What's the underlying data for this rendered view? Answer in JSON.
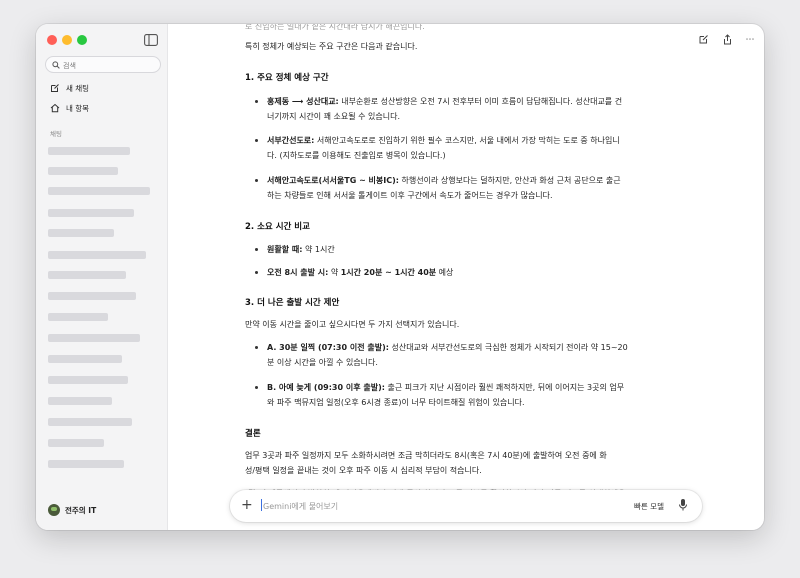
{
  "sidebar": {
    "search_placeholder": "검색",
    "new_chat": "새 채팅",
    "my_items": "내 항목",
    "section_chats": "채팅",
    "profile_name": "전주의 IT"
  },
  "content": {
    "faded_top": "로 진입하는 일대가 짙은 시간대라 답시가 해끈입니다.",
    "intro": "특히 정체가 예상되는 주요 구간은 다음과 같습니다.",
    "s1_title": "1. 주요 정체 예상 구간",
    "s1_b1_bold": "홍제동 ⟶ 성산대교:",
    "s1_b1_l1": " 내부순환로 성산방향은 오전 7시 전후부터 이미 흐름이 답답해집니다. 성산대교를 건",
    "s1_b1_l2": "너기까지 시간이 꽤 소요될 수 있습니다.",
    "s1_b2_bold": "서부간선도로:",
    "s1_b2_l1": " 서해안고속도로로 진입하기 위한 필수 코스지만, 서울 내에서 가장 막히는 도로 중 하나입니",
    "s1_b2_l2": "다. (지하도로를 이용해도 진출입로 병목이 있습니다.)",
    "s1_b3_bold": "서해안고속도로(서서울TG ~ 비봉IC):",
    "s1_b3_l1": " 하행선이라 상행보다는 덜하지만, 안산과 화성 근처 공단으로 출근",
    "s1_b3_l2": "하는 차량들로 인해 서서울 톨게이트 이후 구간에서 속도가 줄어드는 경우가 많습니다.",
    "s2_title": "2. 소요 시간 비교",
    "s2_b1_bold": "원활할 때:",
    "s2_b1_text": " 약 1시간",
    "s2_b2_bold": "오전 8시 출발 시:",
    "s2_b2_text": " 약 ",
    "s2_b2_value": "1시간 20분 ~ 1시간 40분",
    "s2_b2_tail": " 예상",
    "s3_title": "3. 더 나은 출발 시간 제안",
    "s3_intro": "만약 이동 시간을 줄이고 싶으시다면 두 가지 선택지가 있습니다.",
    "s3_b1_bold": "A. 30분 일찍 (07:30 이전 출발):",
    "s3_b1_l1": " 성산대교와 서부간선도로의 극심한 정체가 시작되기 전이라 약 15~20",
    "s3_b1_l2": "분 이상 시간을 아낄 수 있습니다.",
    "s3_b2_bold": "B. 아예 늦게 (09:30 이후 출발):",
    "s3_b2_l1": " 출근 피크가 지난 시점이라 훨씬 쾌적하지만, 뒤에 이어지는 3곳의 업무",
    "s3_b2_l2": "와 파주 맥뮤지엄 일정(오후 6시경 종료)이 너무 타이트해질 위험이 있습니다.",
    "conclusion_title": "결론",
    "conclusion_l1": "업무 3곳과 파주 일정까지 모두 소화하시려면 조금 막히더라도 8시(혹은 7시 40분)에 출발하여 오전 중에 화",
    "conclusion_l2": "성/평택 일정을 끝내는 것이 오후 파주 이동 시 심리적 부담이 적습니다.",
    "faded_bottom": "[팁] 홍제동에서 출발하실 때 카카오내비나 티맵 등의 실시간 교통 정보를 확인하시어 가장 빠른 경로를 선택하세요."
  },
  "composer": {
    "placeholder": "Gemini에게 물어보기",
    "model_label": "빠른 모델"
  }
}
